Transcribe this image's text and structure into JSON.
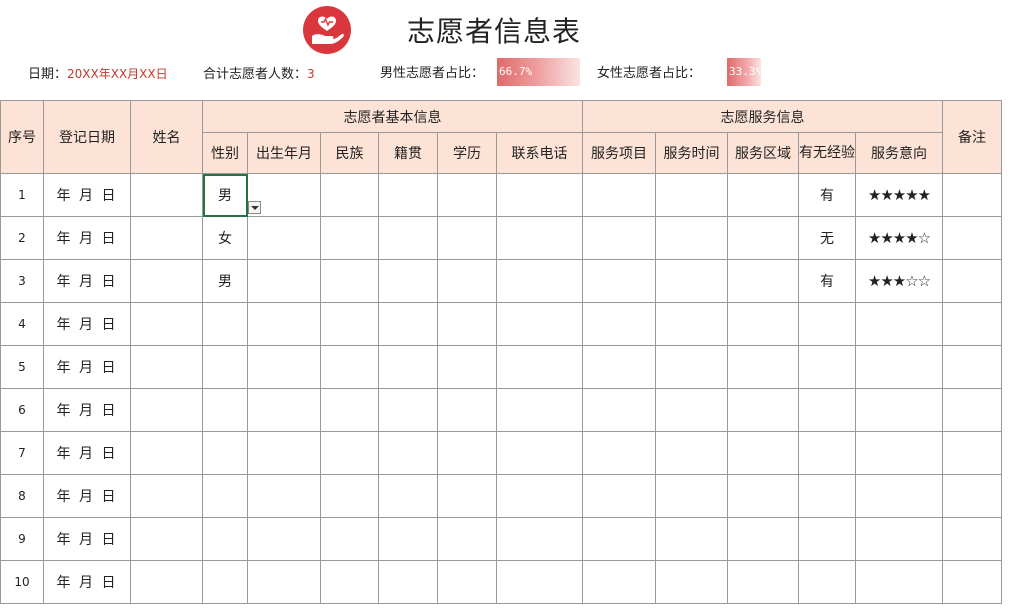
{
  "sheet": {
    "title": "志愿者信息表",
    "logo_icon": "heart-in-hand-icon",
    "accent_color": "#d9363e",
    "header_fill": "#fde3d6",
    "selection_color": "#217346"
  },
  "info": {
    "date_label": "日期：",
    "date_value": "20XX年XX月XX日",
    "count_label": "合计志愿者人数：",
    "count_value": "3",
    "male_ratio_label": "男性志愿者占比：",
    "male_ratio_value": "66.7%",
    "male_ratio": 0.667,
    "female_ratio_label": "女性志愿者占比：",
    "female_ratio_value": "33.3%",
    "female_ratio": 0.333
  },
  "table": {
    "headers": {
      "seq": "序号",
      "reg_date": "登记日期",
      "name": "姓名",
      "basic_group": "志愿者基本信息",
      "gender": "性别",
      "birth": "出生年月",
      "ethnicity": "民族",
      "native_place": "籍贯",
      "education": "学历",
      "phone": "联系电话",
      "service_group": "志愿服务信息",
      "service_item": "服务项目",
      "service_time": "服务时间",
      "service_area": "服务区域",
      "experience": "有无经验",
      "intent": "服务意向",
      "notes": "备注"
    },
    "date_placeholder": "年 月 日",
    "rows": [
      {
        "seq": "1",
        "gender": "男",
        "experience": "有",
        "intent": "★★★★★"
      },
      {
        "seq": "2",
        "gender": "女",
        "experience": "无",
        "intent": "★★★★☆"
      },
      {
        "seq": "3",
        "gender": "男",
        "experience": "有",
        "intent": "★★★☆☆"
      },
      {
        "seq": "4",
        "gender": "",
        "experience": "",
        "intent": ""
      },
      {
        "seq": "5",
        "gender": "",
        "experience": "",
        "intent": ""
      },
      {
        "seq": "6",
        "gender": "",
        "experience": "",
        "intent": ""
      },
      {
        "seq": "7",
        "gender": "",
        "experience": "",
        "intent": ""
      },
      {
        "seq": "8",
        "gender": "",
        "experience": "",
        "intent": ""
      },
      {
        "seq": "9",
        "gender": "",
        "experience": "",
        "intent": ""
      },
      {
        "seq": "10",
        "gender": "",
        "experience": "",
        "intent": ""
      }
    ]
  }
}
